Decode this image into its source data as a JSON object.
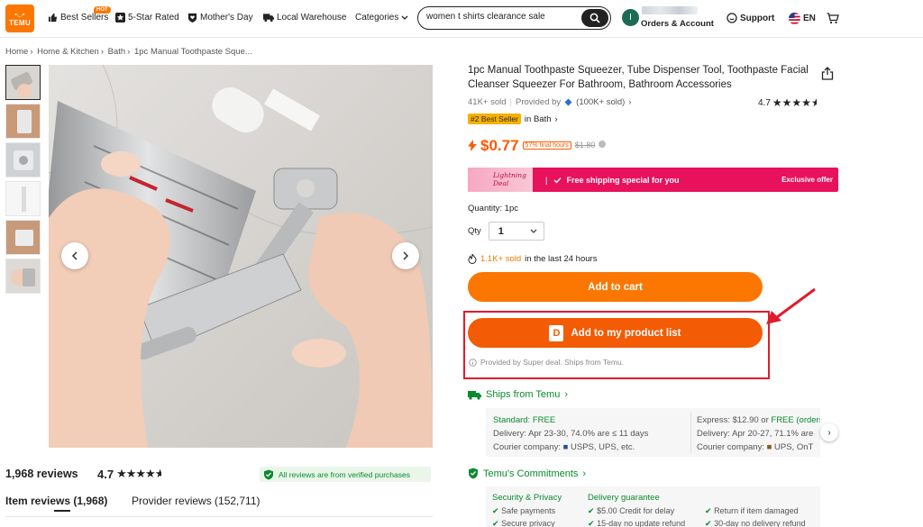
{
  "header": {
    "logo_text": "TEMU",
    "nav": [
      {
        "label": "Best Sellers",
        "badge": "HOT",
        "icon": "thumb-up-icon"
      },
      {
        "label": "5-Star Rated",
        "icon": "star-box-icon"
      },
      {
        "label": "Mother's Day",
        "icon": "heart-shield-icon"
      },
      {
        "label": "Local Warehouse",
        "icon": "truck-icon"
      },
      {
        "label": "Categories",
        "icon": "chevron-down-icon"
      }
    ],
    "search_value": "women t shirts clearance sale",
    "avatar_letter": "I",
    "orders_label": "Orders & Account",
    "support_label": "Support",
    "language": "EN"
  },
  "breadcrumb": [
    "Home",
    "Home & Kitchen",
    "Bath",
    "1pc Manual Toothpaste Sque..."
  ],
  "reviews": {
    "count_label": "1,968 reviews",
    "rating": "4.7",
    "verified_label": "All reviews are from verified purchases",
    "tab_item": "Item reviews (1,968)",
    "tab_provider": "Provider reviews (152,711)"
  },
  "product": {
    "title": "1pc Manual Toothpaste Squeezer, Tube Dispenser Tool, Toothpaste Facial Cleanser Squeezer For Bathroom, Bathroom Accessories",
    "sold": "41K+ sold",
    "provided_by": "Provided by",
    "provider_sold": "(100K+ sold)",
    "rating": "4.7",
    "best_seller_tag": "#2 Best Seller",
    "best_seller_in": "in Bath",
    "price": "$0.77",
    "discount": "57% final hours",
    "old_price": "$1.80",
    "lightning_title": "Lightning Deal",
    "free_shipping": "Free shipping special for you",
    "exclusive": "Exclusive offer",
    "quantity_label": "Quantity: 1pc",
    "qty_label": "Qty",
    "qty_value": "1",
    "sold_24_count": "1.1K+ sold",
    "sold_24_rest": "in the last 24 hours",
    "add_to_cart": "Add to cart",
    "add_to_list": "Add to my product list",
    "d_icon_letter": "D",
    "provided_note": "Provided by Super deal. Ships from Temu."
  },
  "shipping": {
    "title": "Ships from Temu",
    "standard": {
      "head_label": "Standard:",
      "head_value": "FREE",
      "delivery": "Delivery: Apr 23-30, 74.0% are ≤ 11 days",
      "courier": "Courier company:",
      "couriers": "USPS, UPS, etc."
    },
    "express": {
      "head_label": "Express: $12.90 or",
      "head_value": "FREE (orders",
      "delivery": "Delivery: Apr 20-27, 71.1% are",
      "courier": "Courier company:",
      "couriers": "UPS, OnT"
    }
  },
  "commitments": {
    "title": "Temu's Commitments",
    "col1": {
      "head": "Security & Privacy",
      "items": [
        "Safe payments",
        "Secure privacy"
      ]
    },
    "col2": {
      "head": "Delivery guarantee",
      "items": [
        "$5.00 Credit for delay",
        "15-day no update refund"
      ]
    },
    "col3": {
      "items": [
        "Return if item damaged",
        "30-day no delivery refund"
      ]
    }
  },
  "colors": {
    "brand": "#fb7701",
    "price": "#fb5b01",
    "green": "#0a8a2f",
    "lightning": "#e8115b",
    "highlight": "#e01b2c"
  }
}
